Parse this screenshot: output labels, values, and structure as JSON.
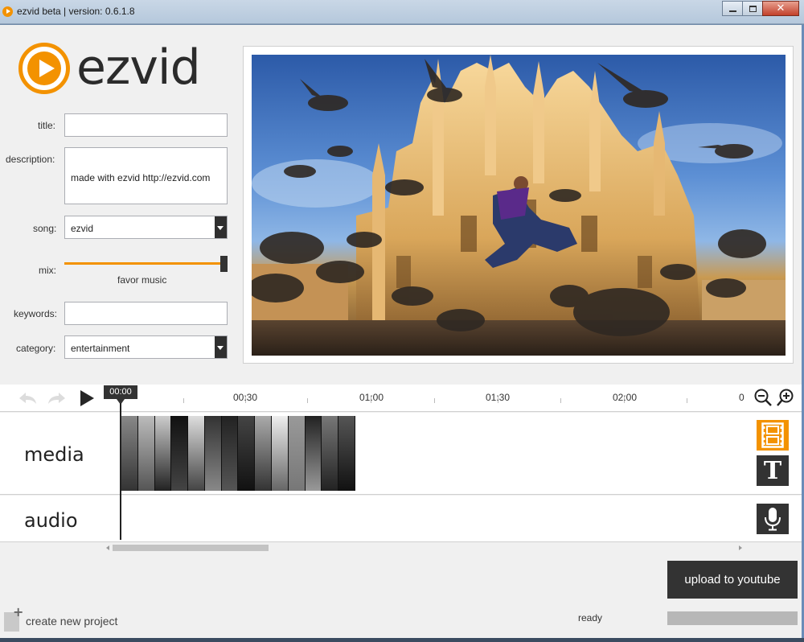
{
  "window": {
    "title": "ezvid beta | version: 0.6.1.8",
    "minimize_glyph": "",
    "close_glyph": "✕"
  },
  "logo": {
    "text": "ezvid",
    "accent": "#f39200"
  },
  "form": {
    "title": {
      "label": "title:",
      "value": ""
    },
    "description": {
      "label": "description:",
      "value": "made with ezvid http://ezvid.com"
    },
    "song": {
      "label": "song:",
      "value": "ezvid"
    },
    "mix": {
      "label": "mix:",
      "caption": "favor music",
      "level": 1.0
    },
    "keywords": {
      "label": "keywords:",
      "value": ""
    },
    "category": {
      "label": "category:",
      "value": "entertainment"
    }
  },
  "preview": {
    "description_icon": "image-preview"
  },
  "timeline": {
    "playhead": "00:00",
    "ticks": [
      "00:30",
      "01:00",
      "01:30",
      "02:00",
      "0"
    ],
    "tracks": {
      "media": "media",
      "audio": "audio"
    },
    "clip_count": 14
  },
  "side_buttons": {
    "text_glyph": "T"
  },
  "bottom": {
    "upload_label": "upload to youtube",
    "new_project_label": "create new project",
    "status": "ready",
    "progress": 0
  },
  "colors": {
    "accent": "#f39200",
    "dark": "#333333"
  }
}
